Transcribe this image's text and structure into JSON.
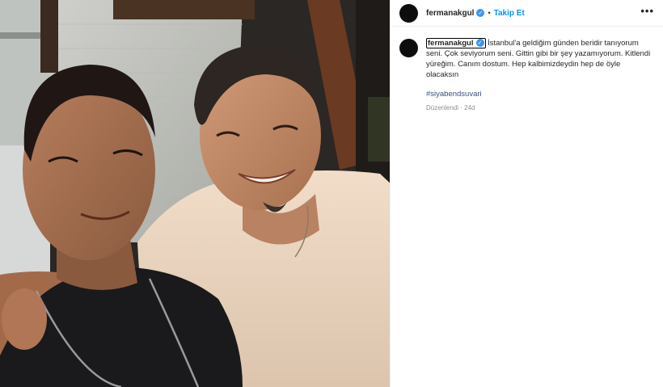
{
  "post": {
    "username": "fermanakgul",
    "follow_label": "Takip Et",
    "separator": "•",
    "more_label": "•••",
    "verified_mark": "✓",
    "caption": {
      "username": "fermanakgul",
      "text": "İstanbul'a geldiğim günden beridir tanıyorum seni. Çok seviyorum seni. Gittin gibi bir şey yazamıyorum. Kitlendi yüreğim. Canım dostum. Hep kalbimizdeydin hep de öyle olacaksın",
      "hashtag": "#siyabendsuvari",
      "meta": "Düzenlendi · 24d"
    }
  },
  "colors": {
    "accent": "#0095f6",
    "hashtag": "#385185",
    "verified": "#3897f0"
  }
}
